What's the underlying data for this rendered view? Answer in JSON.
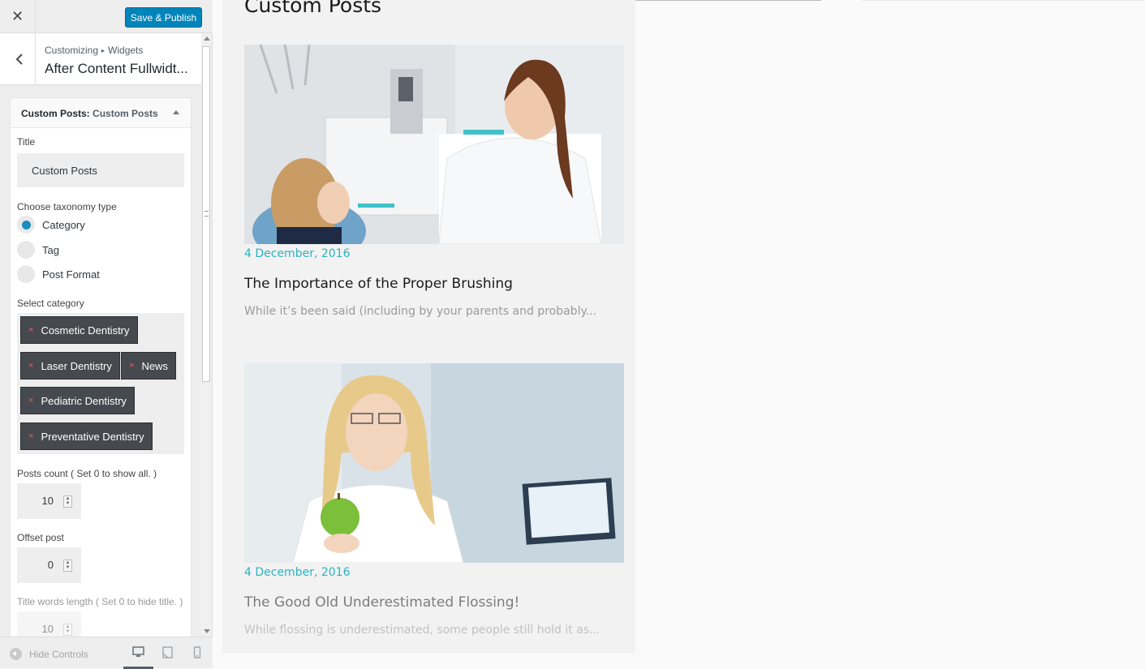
{
  "header": {
    "close_label": "✕",
    "save_label": "Save & Publish"
  },
  "section": {
    "breadcrumb_root": "Customizing",
    "breadcrumb_sep": "▸",
    "breadcrumb_parent": "Widgets",
    "title": "After Content Fullwidt..."
  },
  "widget": {
    "title_prefix": "Custom Posts:",
    "title_name": "Custom Posts",
    "title_label": "Title",
    "title_value": "Custom Posts",
    "taxonomy_label": "Choose taxonomy type",
    "taxonomy_options": [
      "Category",
      "Tag",
      "Post Format"
    ],
    "taxonomy_selected": "Category",
    "category_label": "Select category",
    "categories": [
      "Cosmetic Dentistry",
      "Laser Dentistry",
      "News",
      "Pediatric Dentistry",
      "Preventative Dentistry"
    ],
    "chip_remove": "×",
    "posts_count_label": "Posts count ( Set 0 to show all. )",
    "posts_count_value": "10",
    "offset_label": "Offset post",
    "offset_value": "0",
    "title_words_label": "Title words length ( Set 0 to hide title. )",
    "title_words_value": "10"
  },
  "footer": {
    "hide_controls_label": "Hide Controls"
  },
  "preview": {
    "heading": "Custom Posts",
    "posts": [
      {
        "date": "4 December, 2016",
        "title": "The Importance of the Proper Brushing",
        "excerpt": "While it’s been said (including by your parents and probably..."
      },
      {
        "date": "4 December, 2016",
        "title": "The Good Old Underestimated Flossing!",
        "excerpt": "While flossing is underestimated, some people still hold it as..."
      }
    ]
  },
  "colors": {
    "accent": "#0085ba",
    "date": "#2bb3c0",
    "chip": "#46494d",
    "radio": "#1e8cbe"
  }
}
